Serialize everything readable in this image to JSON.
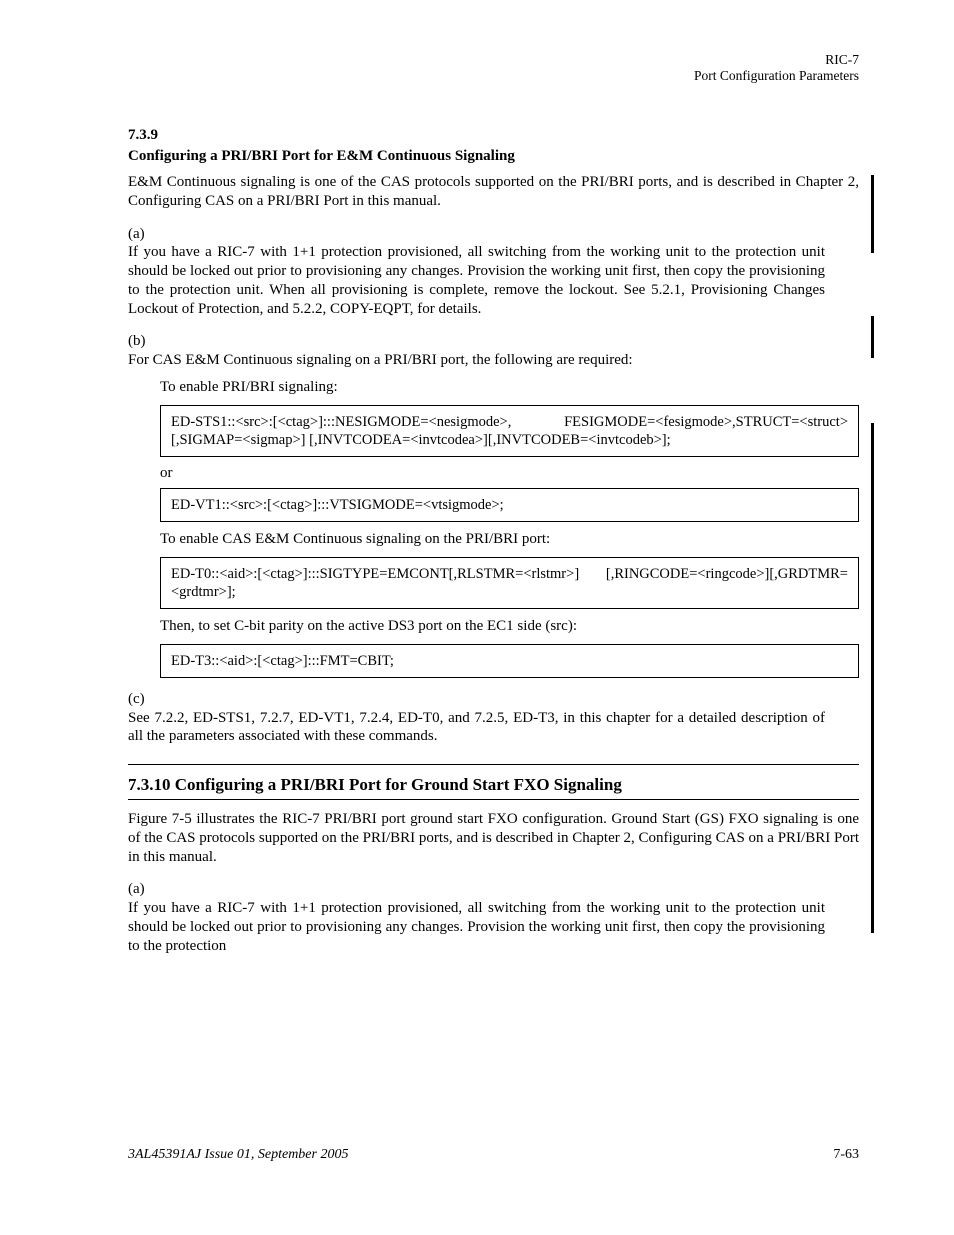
{
  "header": {
    "line1": "RIC-7",
    "line2": "Port Configuration Parameters"
  },
  "section": {
    "number": "7.3.9",
    "title": "Configuring a PRI/BRI Port for E&M Continuous Signaling"
  },
  "para1": "E&M Continuous signaling is one of the CAS protocols supported on the PRI/BRI ports, and is described in Chapter 2, Configuring CAS on a PRI/BRI Port in this manual.",
  "para2": {
    "label": "(a)",
    "text": "If you have a RIC-7 with 1+1 protection provisioned, all switching from the working unit to the protection unit should be locked out prior to provisioning any changes. Provision the working unit first, then copy the provisioning to the protection unit. When all provisioning is complete, remove the lockout. See 5.2.1, Provisioning Changes Lockout of Protection, and 5.2.2, COPY-EQPT, for details."
  },
  "para3": {
    "label": "(b)",
    "text": "For CAS E&M Continuous signaling on a PRI/BRI port, the following are required:"
  },
  "boxes": {
    "intro": "To enable PRI/BRI signaling:",
    "box1": "ED-STS1::<src>:[<ctag>]:::NESIGMODE=<nesigmode>, FESIGMODE=<fesigmode>,STRUCT=<struct>[,SIGMAP=<sigmap>] [,INVTCODEA=<invtcodea>][,INVTCODEB=<invtcodeb>];",
    "or1": "or",
    "box2": "ED-VT1::<src>:[<ctag>]:::VTSIGMODE=<vtsigmode>;",
    "intro2": "To enable CAS E&M Continuous signaling on the PRI/BRI port:",
    "box3": "ED-T0::<aid>:[<ctag>]:::SIGTYPE=EMCONT[,RLSTMR=<rlstmr>] [,RINGCODE=<ringcode>][,GRDTMR=<grdtmr>];",
    "intro3": "Then, to set C-bit parity on the active DS3 port on the EC1 side (src):",
    "box4": "ED-T3::<aid>:[<ctag>]:::FMT=CBIT;"
  },
  "para4": {
    "label": "(c)",
    "text": "See 7.2.2, ED-STS1, 7.2.7, ED-VT1, 7.2.4, ED-T0, and 7.2.5, ED-T3, in this chapter for a detailed description of all the parameters associated with these commands."
  },
  "h3": "7.3.10 Configuring a PRI/BRI Port for Ground Start FXO Signaling",
  "para5": "Figure 7-5 illustrates the RIC-7 PRI/BRI port ground start FXO configuration. Ground Start (GS) FXO signaling is one of the CAS protocols supported on the PRI/BRI ports, and is described in Chapter 2, Configuring CAS on a PRI/BRI Port in this manual.",
  "para6": {
    "label": "(a)",
    "text": "If you have a RIC-7 with 1+1 protection provisioned, all switching from the working unit to the protection unit should be locked out prior to provisioning any changes. Provision the working unit first, then copy the provisioning to the protection"
  },
  "footer": {
    "left": "3AL45391AJ Issue 01, September 2005",
    "right": "7-63"
  }
}
